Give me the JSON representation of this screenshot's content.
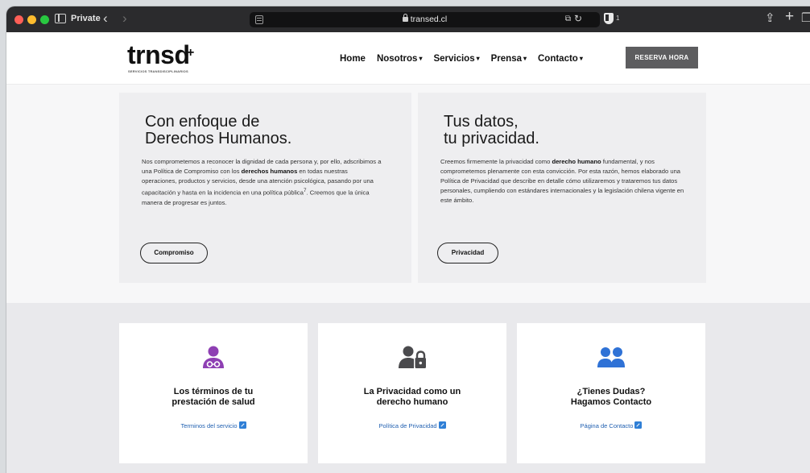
{
  "browser": {
    "private_label": "Private",
    "url": "transed.cl",
    "extension_count": "1",
    "icons": [
      "sidebar-icon",
      "back-icon",
      "forward-icon",
      "tab-overview-icon",
      "lock-icon",
      "translate-icon",
      "reload-icon",
      "shield-extension-icon",
      "share-icon",
      "new-tab-icon",
      "tabs-icon"
    ]
  },
  "header": {
    "logo_text": "trnsd",
    "logo_plus": "+",
    "logo_tagline": "SERVICIOS TRANSDISCIPLINARIOS",
    "nav": [
      {
        "label": "Home",
        "dropdown": false
      },
      {
        "label": "Nosotros",
        "dropdown": true
      },
      {
        "label": "Servicios",
        "dropdown": true
      },
      {
        "label": "Prensa",
        "dropdown": true
      },
      {
        "label": "Contacto",
        "dropdown": true
      }
    ],
    "reserve_label": "RESERVA HORA"
  },
  "panels": {
    "rights": {
      "title_line1": "Con enfoque de",
      "title_line2": "Derechos Humanos.",
      "body_1": "Nos comprometemos a reconocer la dignidad de cada persona y, por ello, adscribimos a una Política de Compromiso con los ",
      "body_bold": "derechos humanos",
      "body_2": " en todas nuestras operaciones, productos y servicios, desde una atención psicológica, pasando por una capacitación y hasta en la incidencia en una política pública",
      "body_sup": "7",
      "body_3": ". Creemos que la única manera de progresar es juntos.",
      "button": "Compromiso"
    },
    "privacy": {
      "title_line1": "Tus datos,",
      "title_line2": "tu privacidad.",
      "body_1": "Creemos firmemente la privacidad como ",
      "body_bold": "derecho humano",
      "body_2": " fundamental, y nos comprometemos plenamente con esta convicción. Por esta razón, hemos elaborado una Política de Privacidad que describe en detalle cómo utilizaremos y trataremos tus datos personales, cumpliendo con estándares internacionales y la legislación chilena vigente en este ámbito.",
      "button": "Privacidad"
    }
  },
  "cards": [
    {
      "icon": "user-doctor-icon",
      "title_line1": "Los términos de tu",
      "title_line2": "prestación de salud",
      "link": "Terminos del servicio",
      "icon_color": "#8e3fb3"
    },
    {
      "icon": "user-lock-icon",
      "title_line1": "La Privacidad como un",
      "title_line2": "derecho humano",
      "link": "Política de Privacidad",
      "icon_color": "#4a4a4d"
    },
    {
      "icon": "user-group-icon",
      "title_line1": "¿Tienes Dudas?",
      "title_line2": "Hagamos Contacto",
      "link": "Página de Contacto",
      "icon_color": "#2f72d6"
    }
  ],
  "colors": {
    "link": "#1f5fb0",
    "reserve_button": "#5d5d5f",
    "panel_bg": "#eeeef0",
    "band_bg": "#e9e9ec"
  }
}
